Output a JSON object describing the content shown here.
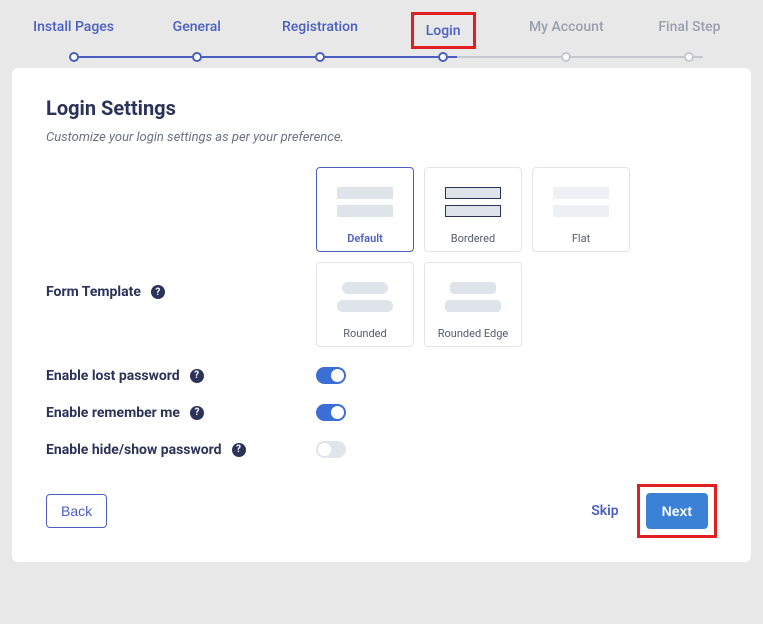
{
  "stepper": {
    "steps": [
      {
        "label": "Install Pages",
        "state": "done"
      },
      {
        "label": "General",
        "state": "done"
      },
      {
        "label": "Registration",
        "state": "done"
      },
      {
        "label": "Login",
        "state": "active"
      },
      {
        "label": "My Account",
        "state": "pending"
      },
      {
        "label": "Final Step",
        "state": "pending"
      }
    ]
  },
  "page": {
    "title": "Login Settings",
    "subtitle": "Customize your login settings as per your preference."
  },
  "form_template": {
    "label": "Form Template",
    "options": [
      {
        "name": "Default",
        "selected": true,
        "style": "filled"
      },
      {
        "name": "Bordered",
        "selected": false,
        "style": "bordered"
      },
      {
        "name": "Flat",
        "selected": false,
        "style": "flat"
      },
      {
        "name": "Rounded",
        "selected": false,
        "style": "pill"
      },
      {
        "name": "Rounded Edge",
        "selected": false,
        "style": "redge"
      }
    ]
  },
  "toggles": {
    "lost_password": {
      "label": "Enable lost password",
      "value": true
    },
    "remember_me": {
      "label": "Enable remember me",
      "value": true
    },
    "hide_show_password": {
      "label": "Enable hide/show password",
      "value": false
    }
  },
  "footer": {
    "back": "Back",
    "skip": "Skip",
    "next": "Next"
  }
}
